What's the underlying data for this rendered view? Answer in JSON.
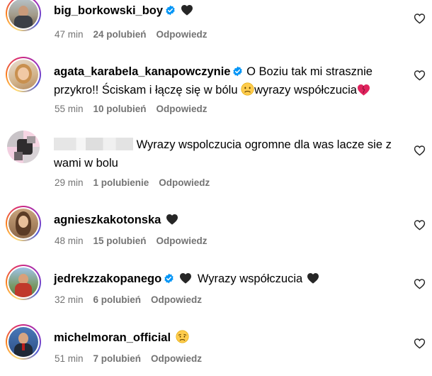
{
  "comments": [
    {
      "username": "big_borkowski_boy",
      "verified": true,
      "text_prefix": "",
      "text": "",
      "time": "47 min",
      "likes": "24 polubień",
      "reply": "Odpowiedz"
    },
    {
      "username": "agata_karabela_kanapowczynie",
      "verified": true,
      "text": "O Boziu tak mi strasznie przykro!! Ściskam i łączę się w bólu",
      "text_after": "wyrazy współczucia",
      "time": "55 min",
      "likes": "10 polubień",
      "reply": "Odpowiedz"
    },
    {
      "username": "",
      "verified": false,
      "text": "Wyrazy wspolczucia ogromne dla was lacze sie z wami w bolu",
      "time": "29 min",
      "likes": "1 polubienie",
      "reply": "Odpowiedz"
    },
    {
      "username": "agnieszkakotonska",
      "verified": false,
      "time": "48 min",
      "likes": "15 polubień",
      "reply": "Odpowiedz"
    },
    {
      "username": "jedrekzzakopanego",
      "verified": true,
      "text": "Wyrazy współczucia",
      "time": "32 min",
      "likes": "6 polubień",
      "reply": "Odpowiedz"
    },
    {
      "username": "michelmoran_official",
      "verified": false,
      "time": "51 min",
      "likes": "7 polubień",
      "reply": "Odpowiedz"
    }
  ],
  "colors": {
    "verified": "#0095f6",
    "meta": "#737373",
    "black_heart": "#262626",
    "red_heart": "#e0245e"
  },
  "icons": {
    "like": "heart-outline-icon",
    "verified": "verified-badge-icon",
    "black_heart": "black-heart-emoji",
    "sad": "sad-face-emoji"
  }
}
